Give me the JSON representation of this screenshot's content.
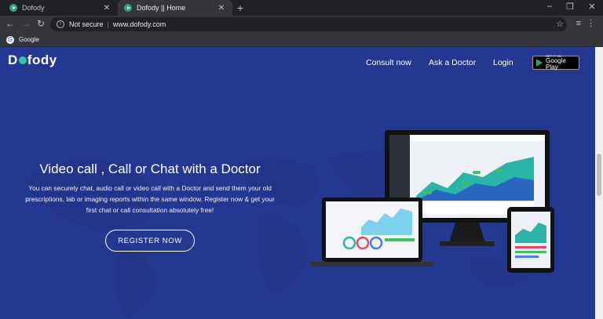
{
  "browser": {
    "tabs": [
      {
        "title": "Dofody"
      },
      {
        "title": "Dofody || Home"
      }
    ],
    "security_label": "Not secure",
    "url": "www.dofody.com",
    "bookmarks": [
      {
        "label": "Google"
      }
    ],
    "icons": {
      "back": "arrow-left-icon",
      "forward": "arrow-right-icon",
      "reload": "reload-icon",
      "info": "info-icon",
      "star": "star-icon",
      "extension": "extension-icon",
      "menu": "kebab-menu-icon"
    }
  },
  "site": {
    "logo_text": "Dofody",
    "nav": [
      {
        "label": "Consult now"
      },
      {
        "label": "Ask a Doctor"
      },
      {
        "label": "Login"
      }
    ],
    "store_badge": {
      "small": "GET IT ON",
      "big": "Google Play"
    },
    "hero": {
      "title": "Video call , Call or Chat with a Doctor",
      "description": "You can securely chat, audio call or video call with a Doctor and send them your old prescriptions, lab or imaging reports within the same window. Register now & get your first chat or call consultation absolutely free!",
      "cta": "REGISTER NOW"
    },
    "colors": {
      "background": "#253891",
      "accent": "#2dc6a5"
    }
  }
}
